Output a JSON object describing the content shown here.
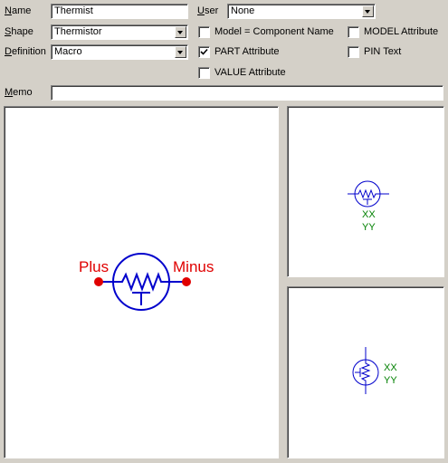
{
  "form": {
    "name_label": "Name",
    "name_value": "Thermist",
    "shape_label": "Shape",
    "shape_value": "Thermistor",
    "definition_label": "Definition",
    "definition_value": "Macro",
    "user_label": "User",
    "user_value": "None",
    "memo_label": "Memo",
    "memo_value": ""
  },
  "checkboxes": {
    "model_component_name": {
      "label": "Model = Component Name",
      "checked": false
    },
    "part_attribute": {
      "label": "PART Attribute",
      "checked": true
    },
    "value_attribute": {
      "label": "VALUE Attribute",
      "checked": false
    },
    "model_attribute": {
      "label": "MODEL Attribute",
      "checked": false
    },
    "pin_text": {
      "label": "PIN Text",
      "checked": false
    }
  },
  "preview": {
    "plus_label": "Plus",
    "minus_label": "Minus",
    "small_label_1": "XX",
    "small_label_2": "YY",
    "colors": {
      "symbol": "#0000cc",
      "pin_label": "#ff0000",
      "attr_text": "#008000"
    }
  }
}
